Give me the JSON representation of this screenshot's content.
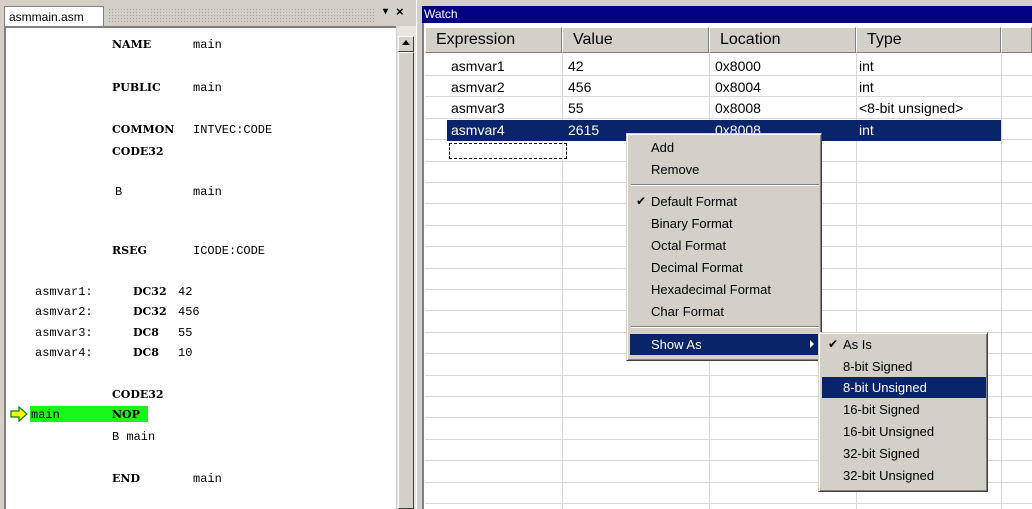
{
  "editor": {
    "tab_label": "asmmain.asm",
    "dropdown_glyph": "▾",
    "close_glyph": "×",
    "lines": [
      {
        "label": "",
        "op": "NAME",
        "arg": "main"
      },
      {
        "label": "",
        "op": "PUBLIC",
        "arg": "main"
      },
      {
        "label": "",
        "op": "COMMON",
        "arg": "INTVEC:CODE"
      },
      {
        "label": "",
        "op": "CODE32",
        "arg": ""
      },
      {
        "label": "",
        "op": "B",
        "arg": "main"
      },
      {
        "label": "",
        "op": "RSEG",
        "arg": "ICODE:CODE"
      },
      {
        "label": "asmvar1:",
        "op": "DC32",
        "arg": "42"
      },
      {
        "label": "asmvar2:",
        "op": "DC32",
        "arg": "456"
      },
      {
        "label": "asmvar3:",
        "op": "DC8",
        "arg": "55"
      },
      {
        "label": "asmvar4:",
        "op": "DC8",
        "arg": "10"
      },
      {
        "label": "",
        "op": "CODE32",
        "arg": ""
      },
      {
        "label": "main",
        "op": "NOP",
        "arg": ""
      },
      {
        "label": "",
        "op": "B main",
        "arg": ""
      },
      {
        "label": "",
        "op": "END",
        "arg": "main"
      }
    ],
    "current_line_color": "#1af51a"
  },
  "watch": {
    "title": "Watch",
    "columns": [
      "Expression",
      "Value",
      "Location",
      "Type"
    ],
    "rows": [
      {
        "expression": "asmvar1",
        "value": "42",
        "location": "0x8000",
        "type": "int"
      },
      {
        "expression": "asmvar2",
        "value": "456",
        "location": "0x8004",
        "type": "int"
      },
      {
        "expression": "asmvar3",
        "value": "55",
        "location": "0x8008",
        "type": "<8-bit unsigned>"
      },
      {
        "expression": "asmvar4",
        "value": "2615",
        "location": "0x8008",
        "type": "int"
      }
    ],
    "selection_color": "#0a246a"
  },
  "context_menu": {
    "items": {
      "add": "Add",
      "remove": "Remove",
      "default_format": "Default Format",
      "binary_format": "Binary Format",
      "octal_format": "Octal Format",
      "decimal_format": "Decimal Format",
      "hexadecimal_format": "Hexadecimal Format",
      "char_format": "Char Format",
      "show_as": "Show As"
    },
    "check_glyph": "✔"
  },
  "show_as_menu": {
    "items": {
      "as_is": "As Is",
      "signed_8": "8-bit Signed",
      "unsigned_8": "8-bit Unsigned",
      "signed_16": "16-bit Signed",
      "unsigned_16": "16-bit Unsigned",
      "signed_32": "32-bit Signed",
      "unsigned_32": "32-bit Unsigned"
    }
  }
}
